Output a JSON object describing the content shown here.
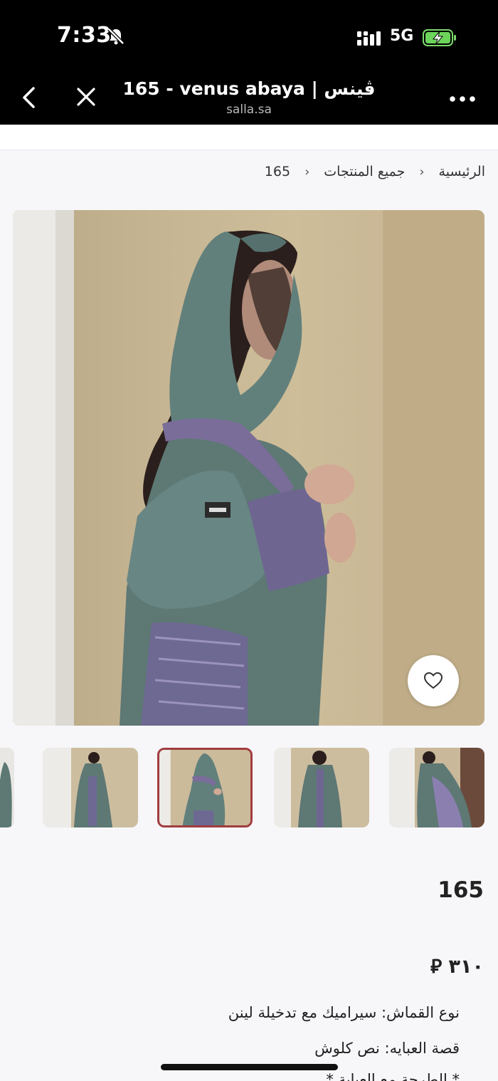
{
  "status_bar": {
    "time": "7:33",
    "network": "5G"
  },
  "browser": {
    "title": "165 - venus abaya | ڤينس",
    "domain": "salla.sa"
  },
  "breadcrumb": {
    "items": [
      "الرئيسية",
      "جميع المنتجات",
      "165"
    ],
    "separator": "›"
  },
  "product": {
    "name": "165",
    "price": "٣١٠ ⃁",
    "description": [
      "نوع القماش: سيراميك مع تدخيلة لينن",
      "قصة العبايه: نص كلوش",
      "* الطرحة مع العباية *"
    ]
  },
  "thumbnails": {
    "count": 6,
    "active_index": 2
  },
  "colors": {
    "accent": "#a13d40",
    "abaya": "#5f7773",
    "wall": "#c7b694"
  }
}
